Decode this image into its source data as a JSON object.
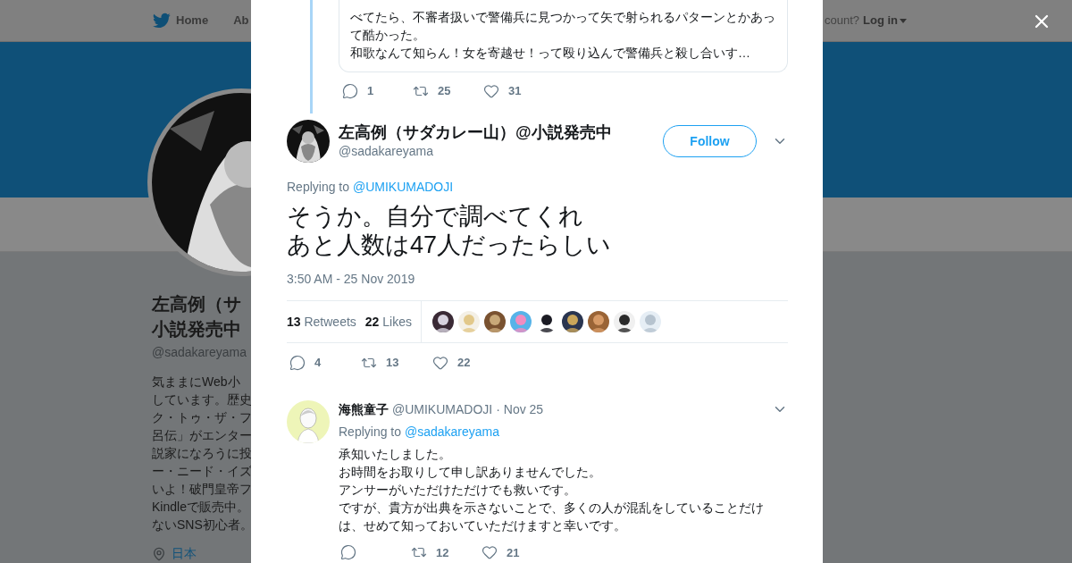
{
  "background_page": {
    "nav": {
      "items": [
        "Home",
        "Ab"
      ],
      "login_prompt": "count?",
      "login": "Log in"
    },
    "profile": {
      "name_lines": [
        "左高例（サ",
        "小説発売中"
      ],
      "handle": "@sadakareyama",
      "bio_lines": [
        "気ままにWeb小",
        "しています。歴史",
        "ク・トゥ・ザ・フ",
        "呂伝」がエンター",
        "説家になろうに投",
        "ー・ニード・イズ",
        "いよ！破門皇帝フ",
        "Kindleで販売中。",
        "ないSNS初心者。"
      ],
      "location": "日本"
    }
  },
  "previous_tweet": {
    "quote_lines": [
      "べてたら、不審者扱いで警備兵に見つかって矢で射られるパターンとかあって酷かった。",
      "和歌なんて知らん！女を寄越せ！って殴り込んで警備兵と殺し合いす…"
    ],
    "actions": {
      "replies": "1",
      "retweets": "25",
      "likes": "31"
    }
  },
  "main_tweet": {
    "author_name": "左高例（サダカレー山）@小説発売中",
    "handle": "@sadakareyama",
    "follow": "Follow",
    "replying_label": "Replying to",
    "replying_to": "@UMIKUMADOJI",
    "text_lines": [
      "そうか。自分で調べてくれ",
      "あと人数は47人だったらしい"
    ],
    "timestamp": "3:50 AM - 25 Nov 2019",
    "retweet_count": "13",
    "retweets_label": "Retweets",
    "like_count": "22",
    "likes_label": "Likes",
    "actions": {
      "replies": "4",
      "retweets": "13",
      "likes": "22"
    }
  },
  "reply_tweet": {
    "author_name": "海熊童子",
    "handle": "@UMIKUMADOJI",
    "time": "· Nov 25",
    "replying_label": "Replying to",
    "replying_to": "@sadakareyama",
    "text_lines": [
      "承知いたしました。",
      "お時間をお取りして申し訳ありませんでした。",
      "アンサーがいただけただけでも救いです。",
      "ですが、貴方が出典を示さないことで、多くの人が混乱をしていることだけは、せめて知っておいていただけますと幸いです。"
    ],
    "actions": {
      "retweets": "12",
      "likes": "21"
    }
  }
}
